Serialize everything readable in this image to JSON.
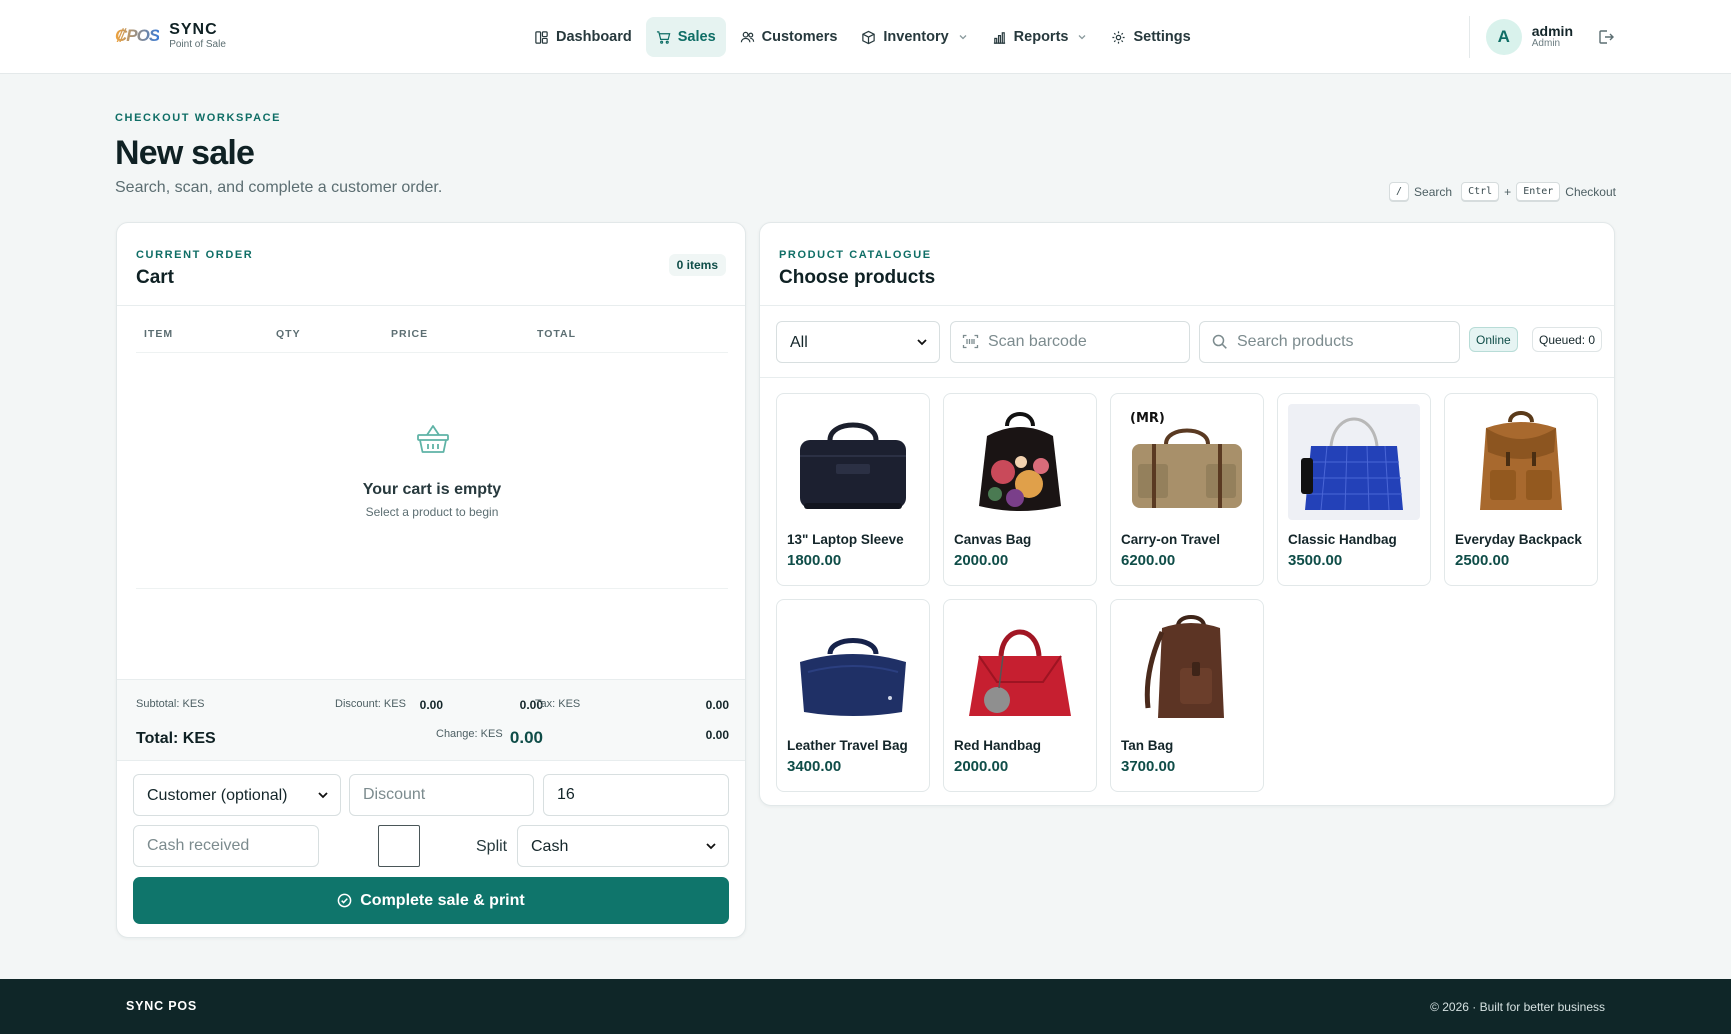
{
  "brand": {
    "logo_text": "₡POS",
    "name": "SYNC",
    "subtitle": "Point of Sale"
  },
  "nav": [
    {
      "label": "Dashboard",
      "icon": "dashboard-icon",
      "active": false
    },
    {
      "label": "Sales",
      "icon": "cart-icon",
      "active": true
    },
    {
      "label": "Customers",
      "icon": "users-icon",
      "active": false
    },
    {
      "label": "Inventory",
      "icon": "box-icon",
      "active": false,
      "has_dropdown": true
    },
    {
      "label": "Reports",
      "icon": "bar-chart-icon",
      "active": false,
      "has_dropdown": true
    },
    {
      "label": "Settings",
      "icon": "gear-icon",
      "active": false
    }
  ],
  "user": {
    "initial": "A",
    "name": "admin",
    "role": "Admin"
  },
  "page": {
    "eyebrow": "CHECKOUT WORKSPACE",
    "title": "New sale",
    "subtitle": "Search, scan, and complete a customer order."
  },
  "shortcuts": {
    "key1": "/",
    "label1": "Search",
    "key2": "Ctrl",
    "plus": "+",
    "key3": "Enter",
    "label2": "Checkout"
  },
  "cart": {
    "eyebrow": "CURRENT ORDER",
    "title": "Cart",
    "items_badge": "0 items",
    "columns": [
      "ITEM",
      "QTY",
      "PRICE",
      "TOTAL"
    ],
    "empty_title": "Your cart is empty",
    "empty_subtitle": "Select a product to begin",
    "subtotal_label": "Subtotal: KES",
    "subtotal": "0.00",
    "discount_label": "Discount: KES",
    "discount": "0.00",
    "tax_label": "Tax: KES",
    "tax": "0.00",
    "total_label": "Total: KES",
    "total": "0.00",
    "change_label": "Change: KES",
    "change": "0.00",
    "customer_selected": "Customer (optional)",
    "discount_placeholder": "Discount",
    "tax_rate_value": "16",
    "cash_placeholder": "Cash received",
    "split_label": "Split",
    "payment_method": "Cash",
    "complete_label": "Complete sale & print"
  },
  "catalogue": {
    "eyebrow": "PRODUCT CATALOGUE",
    "title": "Choose products",
    "category_selected": "All",
    "barcode_placeholder": "Scan barcode",
    "search_placeholder": "Search products",
    "online_label": "Online",
    "queued_label": "Queued: 0",
    "products": [
      {
        "name": "13\" Laptop Sleeve",
        "price": "1800.00"
      },
      {
        "name": "Canvas Bag",
        "price": "2000.00"
      },
      {
        "name": "Carry-on Travel",
        "price": "6200.00"
      },
      {
        "name": "Classic Handbag",
        "price": "3500.00"
      },
      {
        "name": "Everyday Backpack",
        "price": "2500.00"
      },
      {
        "name": "Leather Travel Bag",
        "price": "3400.00"
      },
      {
        "name": "Red Handbag",
        "price": "2000.00"
      },
      {
        "name": "Tan Bag",
        "price": "3700.00"
      }
    ]
  },
  "footer": {
    "brand": "SYNC POS",
    "copyright": "© 2026 · Built for better business"
  },
  "colors": {
    "accent": "#0f756b",
    "accent_light": "#e6f3f1",
    "footer_bg": "#0f2628"
  }
}
